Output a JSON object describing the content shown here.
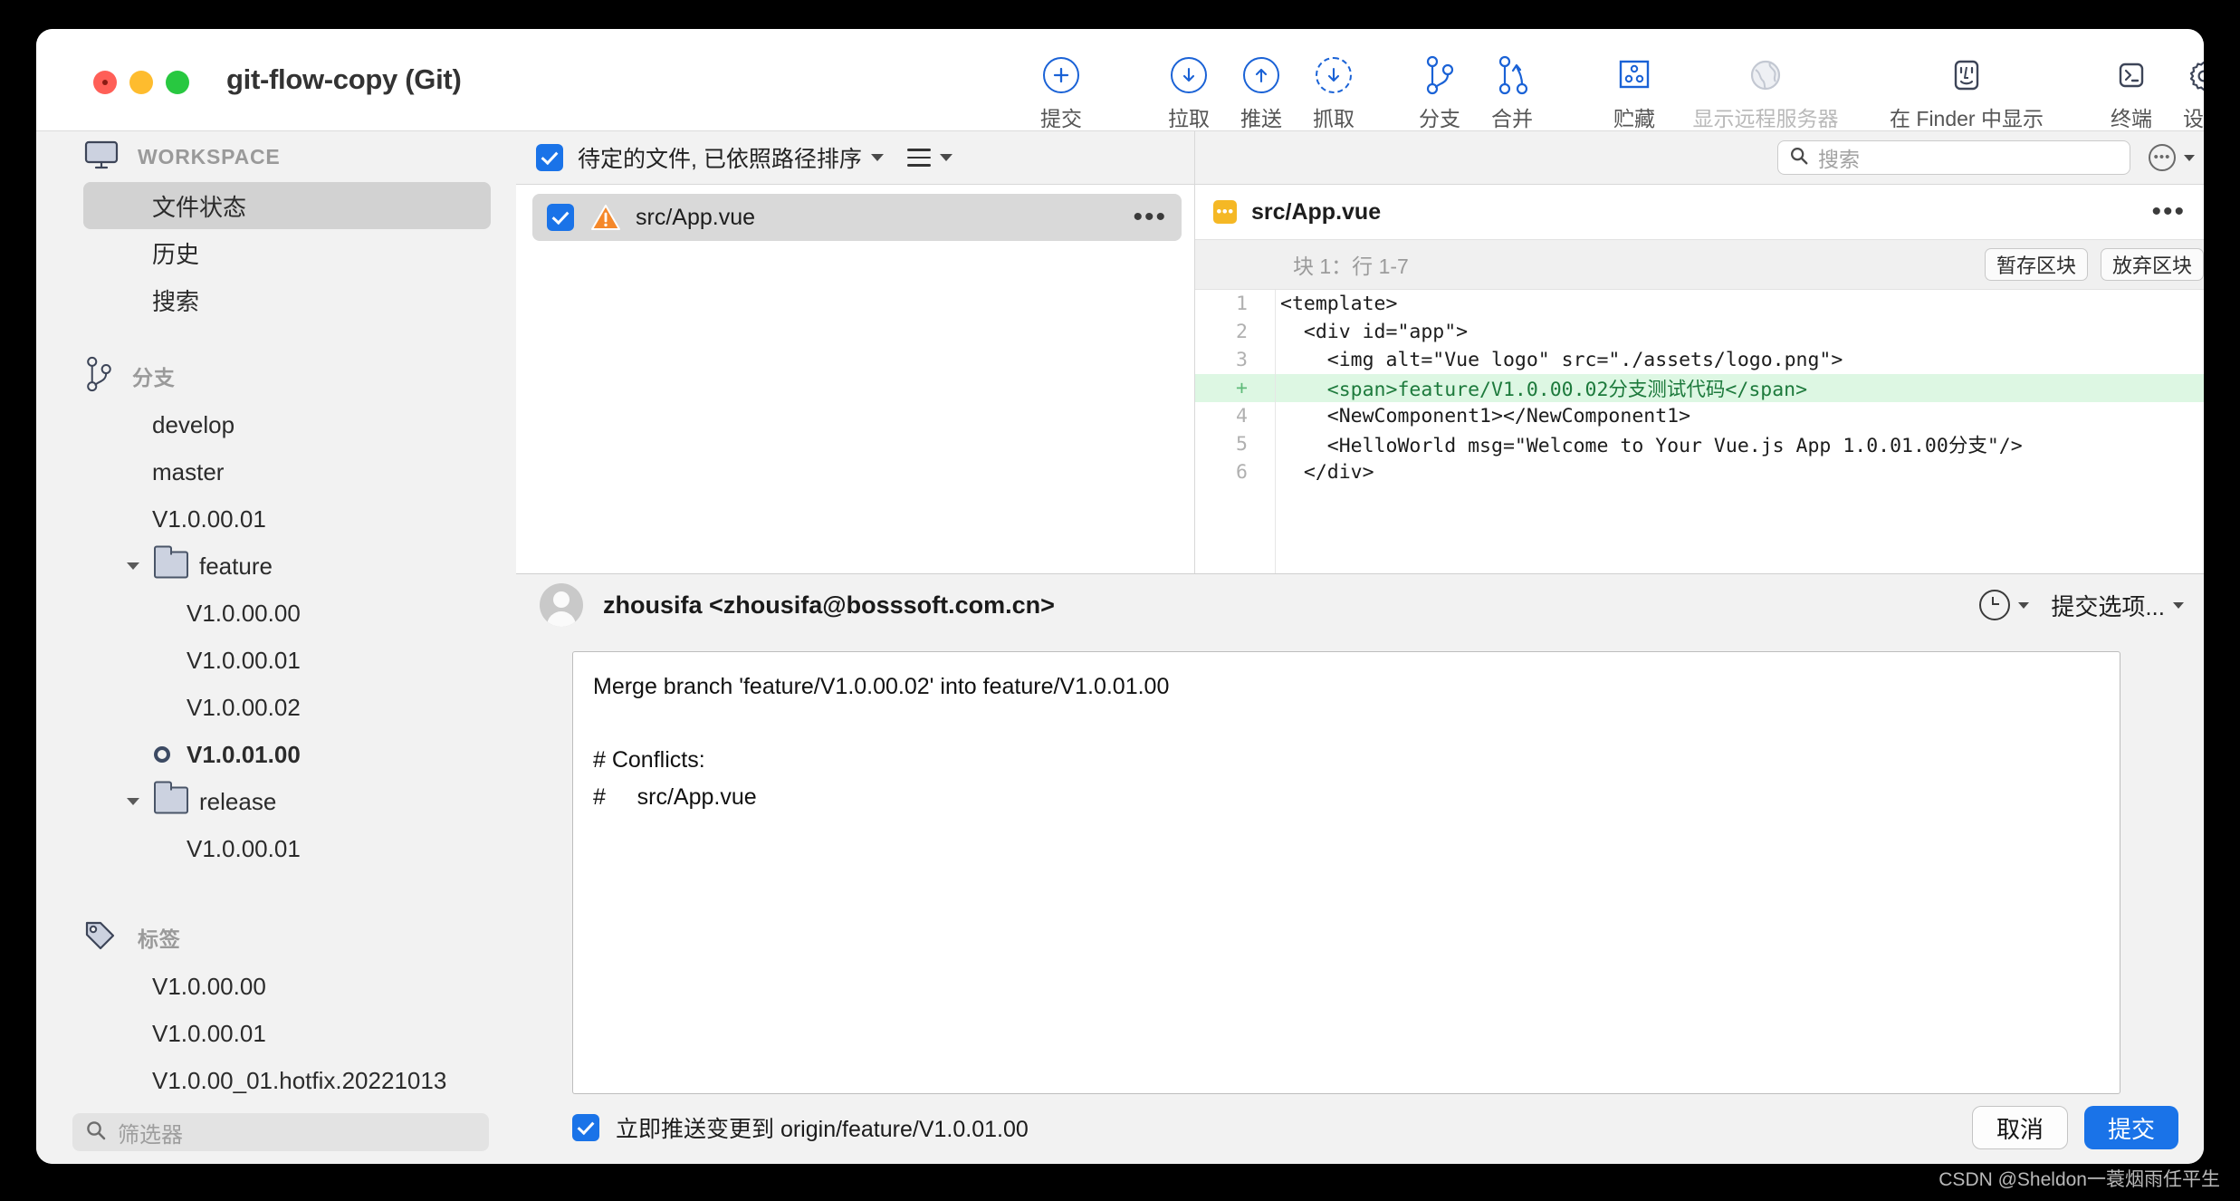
{
  "window": {
    "title": "git-flow-copy (Git)",
    "traffic_lights": [
      "close",
      "minimize",
      "maximize"
    ]
  },
  "toolbar": {
    "items": [
      {
        "label": "提交",
        "icon": "plus-circle-icon",
        "disabled": false
      },
      {
        "label": "拉取",
        "icon": "arrow-down-circle-icon",
        "disabled": false
      },
      {
        "label": "推送",
        "icon": "arrow-up-circle-icon",
        "disabled": false
      },
      {
        "label": "抓取",
        "icon": "arrow-down-dashed-circle-icon",
        "disabled": false
      },
      {
        "label": "分支",
        "icon": "branch-icon",
        "disabled": false
      },
      {
        "label": "合并",
        "icon": "merge-icon",
        "disabled": false
      },
      {
        "label": "贮藏",
        "icon": "stash-icon",
        "disabled": false
      },
      {
        "label": "显示远程服务器",
        "icon": "globe-icon",
        "disabled": true
      },
      {
        "label": "在 Finder 中显示",
        "icon": "finder-icon",
        "disabled": false
      },
      {
        "label": "终端",
        "icon": "terminal-icon",
        "disabled": false
      },
      {
        "label": "设置",
        "icon": "gear-icon",
        "disabled": false
      }
    ]
  },
  "sidebar": {
    "workspace": {
      "heading": "WORKSPACE",
      "items": [
        {
          "label": "文件状态",
          "selected": true
        },
        {
          "label": "历史",
          "selected": false
        },
        {
          "label": "搜索",
          "selected": false
        }
      ]
    },
    "branches": {
      "heading": "分支",
      "items": [
        {
          "label": "develop",
          "type": "branch",
          "current": false
        },
        {
          "label": "master",
          "type": "branch",
          "current": false
        },
        {
          "label": "V1.0.00.01",
          "type": "branch",
          "current": false
        },
        {
          "label": "feature",
          "type": "folder",
          "expanded": true
        },
        {
          "label": "V1.0.00.00",
          "type": "branch-child",
          "current": false
        },
        {
          "label": "V1.0.00.01",
          "type": "branch-child",
          "current": false
        },
        {
          "label": "V1.0.00.02",
          "type": "branch-child",
          "current": false
        },
        {
          "label": "V1.0.01.00",
          "type": "branch-child",
          "current": true
        },
        {
          "label": "release",
          "type": "folder",
          "expanded": true
        },
        {
          "label": "V1.0.00.01",
          "type": "branch-child",
          "current": false
        }
      ]
    },
    "tags": {
      "heading": "标签",
      "items": [
        {
          "label": "V1.0.00.00"
        },
        {
          "label": "V1.0.00.01"
        },
        {
          "label": "V1.0.00_01.hotfix.20221013"
        }
      ]
    },
    "filter": {
      "placeholder": "筛选器",
      "value": ""
    }
  },
  "file_list": {
    "header_label": "待定的文件, 已依照路径排序",
    "header_checked": true,
    "rows": [
      {
        "name": "src/App.vue",
        "checked": true,
        "status": "conflict",
        "status_icon": "warning-triangle-icon"
      }
    ]
  },
  "diff": {
    "search": {
      "placeholder": "搜索",
      "value": ""
    },
    "file_name": "src/App.vue",
    "file_badge_icon": "conflict-badge-icon",
    "hunk_label": "块 1：行 1-7",
    "stage_hunk_label": "暂存区块",
    "discard_hunk_label": "放弃区块",
    "lines": [
      {
        "num": "1",
        "text": "<template>",
        "type": "context"
      },
      {
        "num": "2",
        "text": "  <div id=\"app\">",
        "type": "context"
      },
      {
        "num": "3",
        "text": "    <img alt=\"Vue logo\" src=\"./assets/logo.png\">",
        "type": "context"
      },
      {
        "num": "+",
        "text": "    <span>feature/V1.0.00.02分支测试代码</span>",
        "type": "added"
      },
      {
        "num": "4",
        "text": "    <NewComponent1></NewComponent1>",
        "type": "context"
      },
      {
        "num": "5",
        "text": "    <HelloWorld msg=\"Welcome to Your Vue.js App 1.0.01.00分支\"/>",
        "type": "context"
      },
      {
        "num": "6",
        "text": "  </div>",
        "type": "context"
      }
    ]
  },
  "commit": {
    "author": "zhousifa <zhousifa@bosssoft.com.cn>",
    "history_icon": "clock-icon",
    "options_label": "提交选项...",
    "message": "Merge branch 'feature/V1.0.00.02' into feature/V1.0.01.00\n\n# Conflicts:\n#     src/App.vue",
    "message_placeholder": "",
    "push_checkbox_label": "立即推送变更到 origin/feature/V1.0.01.00",
    "push_checked": true,
    "cancel_label": "取消",
    "commit_label": "提交"
  },
  "watermark": "CSDN @Sheldon一蓑烟雨任平生",
  "colors": {
    "accent": "#1a73e8",
    "toolbar_icon": "#1a62d6",
    "added_line_bg": "#ddf7e3",
    "added_line_fg": "#1d7a3c",
    "warning": "#f5882a",
    "conflict_badge": "#f5b825"
  }
}
